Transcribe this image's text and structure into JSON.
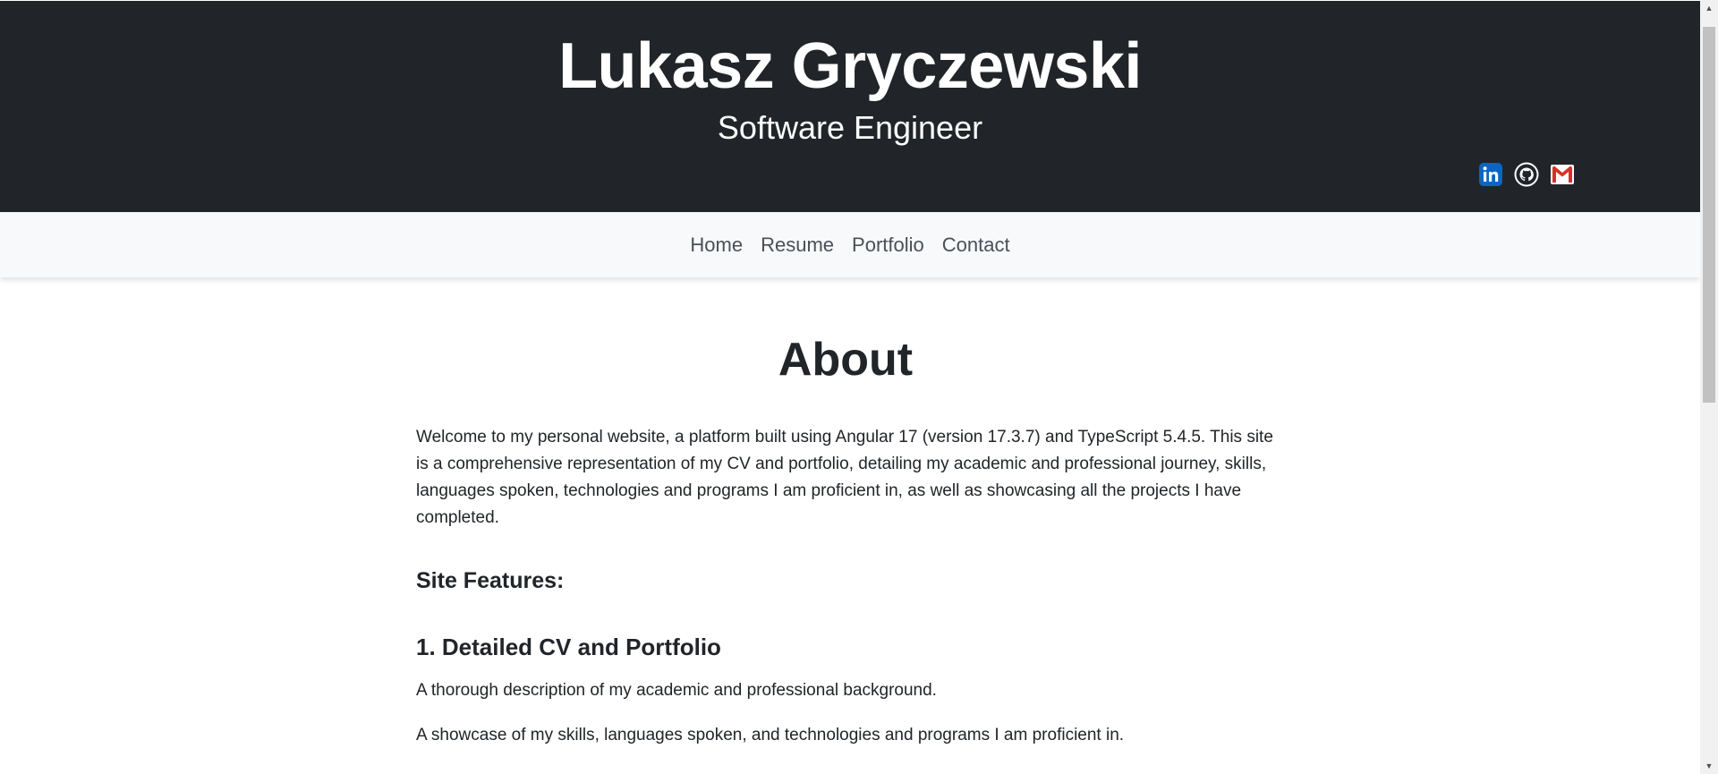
{
  "header": {
    "name": "Lukasz Gryczewski",
    "subtitle": "Software Engineer"
  },
  "social": [
    {
      "name": "linkedin-icon",
      "label": "in",
      "color": "#0a66c2"
    },
    {
      "name": "github-icon",
      "color": "#ffffff"
    },
    {
      "name": "gmail-icon",
      "color": "#d93025"
    }
  ],
  "nav": {
    "home": "Home",
    "resume": "Resume",
    "portfolio": "Portfolio",
    "contact": "Contact"
  },
  "about": {
    "title": "About",
    "intro": "Welcome to my personal website, a platform built using Angular 17 (version 17.3.7) and TypeScript 5.4.5. This site is a comprehensive representation of my CV and portfolio, detailing my academic and professional journey, skills, languages spoken, technologies and programs I am proficient in, as well as showcasing all the projects I have completed.",
    "features_title": "Site Features:",
    "feature1_title": "1. Detailed CV and Portfolio",
    "feature1_p1": "A thorough description of my academic and professional background.",
    "feature1_p2": "A showcase of my skills, languages spoken, and technologies and programs I am proficient in."
  },
  "colors": {
    "header_bg": "#212529",
    "nav_bg": "#f8f9fa",
    "nav_text": "#495057"
  }
}
